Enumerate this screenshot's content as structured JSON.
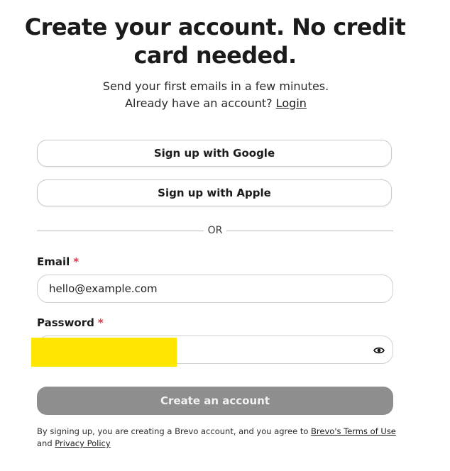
{
  "header": {
    "title": "Create your account. No credit card needed.",
    "subtitle_text": "Send your first emails in a few minutes. Already have an account?",
    "login_link": "Login"
  },
  "oauth": {
    "google_label": "Sign up with Google",
    "apple_label": "Sign up with Apple"
  },
  "divider": {
    "label": "OR"
  },
  "form": {
    "email_label": "Email",
    "email_required_marker": "*",
    "email_value": "hello@example.com",
    "password_label": "Password",
    "password_required_marker": "*",
    "password_value": "",
    "password_visibility_icon": "eye-icon",
    "submit_label": "Create an account",
    "submit_bg_color": "#8e8e8e"
  },
  "legal": {
    "text": "By signing up, you are creating a Brevo account, and you agree to",
    "terms_link": "Brevo's Terms of Use",
    "and_text": "and",
    "privacy_link": "Privacy Policy"
  },
  "colors": {
    "required": "#e0364a",
    "redaction": "#ffe600"
  }
}
